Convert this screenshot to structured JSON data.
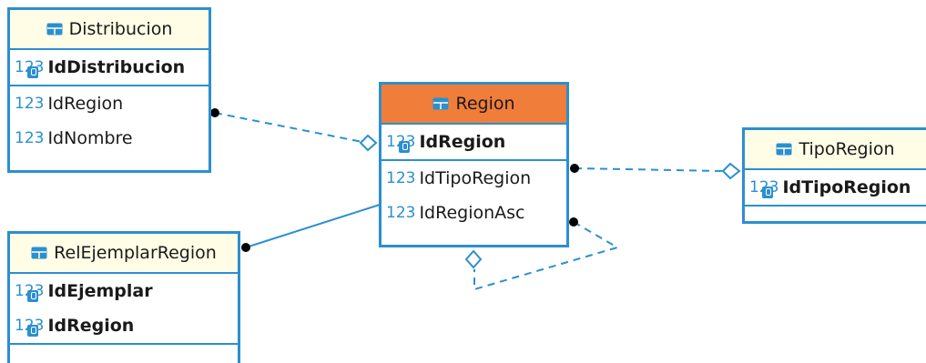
{
  "colors": {
    "border": "#2b8fd0",
    "header_bg": "#fffde6",
    "selected_header_bg": "#f07d3a",
    "type_text": "#2b8fd0"
  },
  "entities": {
    "distribucion": {
      "title": "Distribucion",
      "key_columns": [
        {
          "type": "123",
          "name": "IdDistribucion"
        }
      ],
      "columns": [
        {
          "type": "123",
          "name": "IdRegion"
        },
        {
          "type": "123",
          "name": "IdNombre"
        }
      ]
    },
    "region": {
      "title": "Region",
      "selected": true,
      "key_columns": [
        {
          "type": "123",
          "name": "IdRegion"
        }
      ],
      "columns": [
        {
          "type": "123",
          "name": "IdTipoRegion"
        },
        {
          "type": "123",
          "name": "IdRegionAsc"
        }
      ]
    },
    "tiporegion": {
      "title": "TipoRegion",
      "key_columns": [
        {
          "type": "123",
          "name": "IdTipoRegion"
        }
      ],
      "columns": []
    },
    "relejemplarregion": {
      "title": "RelEjemplarRegion",
      "key_columns": [
        {
          "type": "123",
          "name": "IdEjemplar"
        },
        {
          "type": "123",
          "name": "IdRegion"
        }
      ],
      "columns": []
    }
  }
}
